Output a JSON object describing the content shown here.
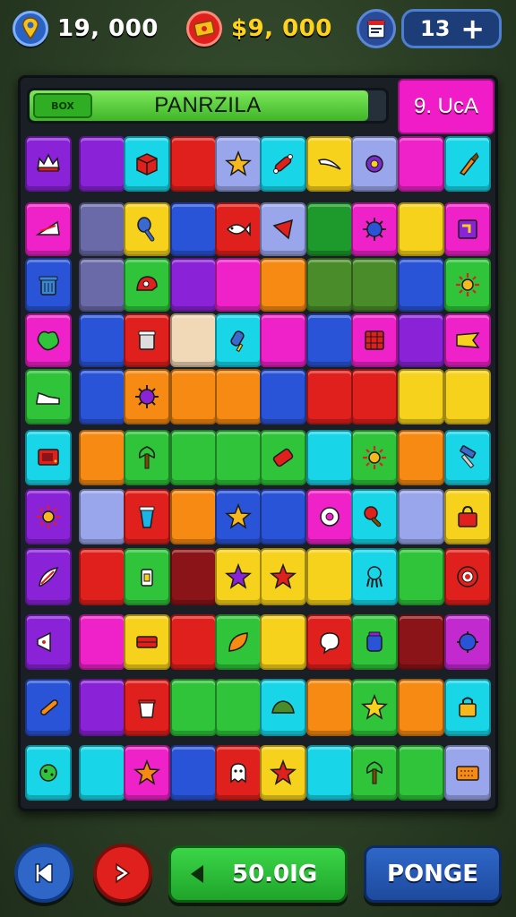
{
  "hud": {
    "location_value": "19, 000",
    "cash_value": "$9, 000",
    "lives_value": "13",
    "add_label": "+"
  },
  "board": {
    "progress_tag": "BOX",
    "progress_label": "PANRZILA",
    "progress_fraction": 0.95,
    "score_text": "9. UcA"
  },
  "bottom": {
    "play_amount": "50.0IG",
    "power_label": "PONGE"
  },
  "colors": {
    "board_bg": "#1a1f26",
    "accent_green": "#1fa42a",
    "accent_blue": "#1d4a9e",
    "accent_red": "#e0201c"
  }
}
